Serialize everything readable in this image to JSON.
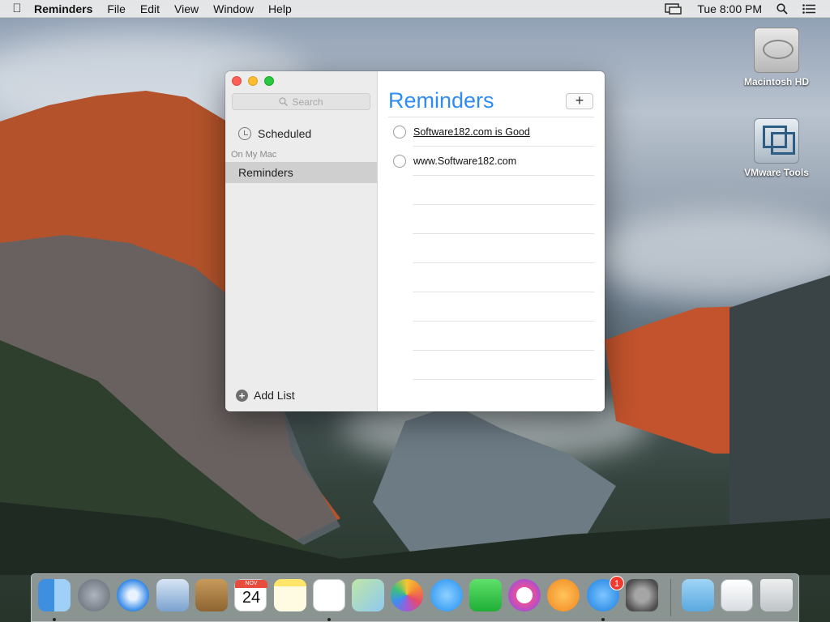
{
  "menubar": {
    "app_name": "Reminders",
    "menus": [
      "File",
      "Edit",
      "View",
      "Window",
      "Help"
    ],
    "clock": "Tue 8:00 PM"
  },
  "desktop": {
    "icons": [
      {
        "label": "Macintosh HD",
        "icon": "hard-drive-icon"
      },
      {
        "label": "VMware Tools",
        "icon": "vmware-tools-icon"
      }
    ]
  },
  "window": {
    "sidebar": {
      "search_placeholder": "Search",
      "scheduled_label": "Scheduled",
      "section_label": "On My Mac",
      "selected_list": "Reminders",
      "add_list_label": "Add List"
    },
    "main": {
      "title": "Reminders",
      "add_button": "+",
      "items": [
        {
          "text": "Software182.com is Good",
          "link": true
        },
        {
          "text": "www.Software182.com",
          "link": false
        }
      ]
    }
  },
  "dock": {
    "apps": [
      {
        "name": "finder-icon",
        "running": true
      },
      {
        "name": "launchpad-icon",
        "running": false
      },
      {
        "name": "safari-icon",
        "running": false
      },
      {
        "name": "mail-icon",
        "running": false
      },
      {
        "name": "contacts-icon",
        "running": false
      },
      {
        "name": "calendar-icon",
        "running": false
      },
      {
        "name": "notes-icon",
        "running": false
      },
      {
        "name": "reminders-icon",
        "running": true
      },
      {
        "name": "maps-icon",
        "running": false
      },
      {
        "name": "photos-icon",
        "running": false
      },
      {
        "name": "messages-icon",
        "running": false
      },
      {
        "name": "facetime-icon",
        "running": false
      },
      {
        "name": "itunes-icon",
        "running": false
      },
      {
        "name": "ibooks-icon",
        "running": false
      },
      {
        "name": "app-store-icon",
        "running": true
      },
      {
        "name": "system-preferences-icon",
        "running": false
      },
      {
        "name": "downloads-folder-icon",
        "running": false
      },
      {
        "name": "documents-stack-icon",
        "running": false
      },
      {
        "name": "trash-icon",
        "running": false
      }
    ],
    "calendar_month": "NOV",
    "calendar_day": "24",
    "app_store_badge": "1"
  }
}
